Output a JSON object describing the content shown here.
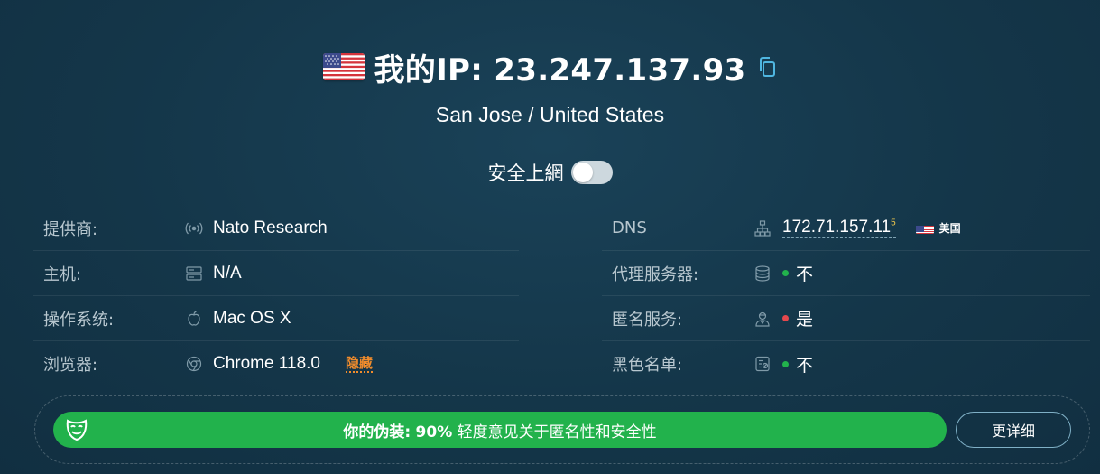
{
  "hero": {
    "ip_title": "我的IP: 23.247.137.93",
    "location": "San Jose / United States",
    "flag_icon": "us-flag-icon"
  },
  "secure_browsing": {
    "label": "安全上網",
    "enabled": false
  },
  "left_rows": [
    {
      "label": "提供商:",
      "value": "Nato Research",
      "icon": "signal-icon"
    },
    {
      "label": "主机:",
      "value": "N/A",
      "icon": "server-icon"
    },
    {
      "label": "操作系统:",
      "value": "Mac OS X",
      "icon": "apple-icon"
    },
    {
      "label": "浏览器:",
      "value": "Chrome 118.0",
      "icon": "chrome-icon",
      "action": "隐藏"
    }
  ],
  "right_rows": [
    {
      "label": "DNS",
      "value": "172.71.157.11",
      "sup": "5",
      "country": "美国",
      "icon": "network-icon"
    },
    {
      "label": "代理服务器:",
      "value": "不",
      "status_color": "#22b24c",
      "icon": "database-icon"
    },
    {
      "label": "匿名服务:",
      "value": "是",
      "status_color": "#e5484d",
      "icon": "anonymous-user-icon"
    },
    {
      "label": "黑色名单:",
      "value": "不",
      "status_color": "#22b24c",
      "icon": "blacklist-icon"
    }
  ],
  "disguise": {
    "prefix": "你的伪装:",
    "percent": "90%",
    "description": "轻度意见关于匿名性和安全性",
    "level": 0.9
  },
  "more_button": "更详细",
  "colors": {
    "accent_green": "#22b24c",
    "warning_orange": "#f08c2c",
    "status_red": "#e5484d",
    "background": "#143649"
  }
}
